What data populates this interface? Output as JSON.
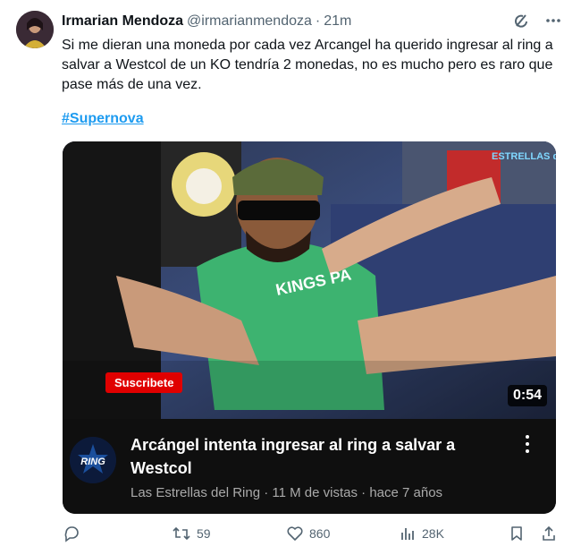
{
  "author": {
    "name": "Irmarian Mendoza",
    "handle": "@irmarianmendoza",
    "separator": "·",
    "time": "21m"
  },
  "tweet": {
    "text": "Si me dieran una moneda por cada vez Arcangel ha querido ingresar al ring a salvar a Westcol de un KO tendría 2 monedas, no es mucho pero es raro que pase más de una vez.",
    "hashtag": "#Supernova"
  },
  "video": {
    "duration": "0:54",
    "subscribe_label": "Suscribete",
    "watermark": "ESTRELLAS del RING",
    "shirt_text": "KINGS PA",
    "title": "Arcángel intenta ingresar al ring a salvar a Westcol",
    "meta": "Las Estrellas del Ring · 11 M de vistas · hace 7 años",
    "channel_logo_text": "RING"
  },
  "actions": {
    "replies": "",
    "retweets": "59",
    "likes": "860",
    "views": "28K"
  },
  "icons": {
    "grok": "grok-icon",
    "more": "more-icon",
    "reply": "reply-icon",
    "retweet": "retweet-icon",
    "like": "heart-icon",
    "views": "views-icon",
    "bookmark": "bookmark-icon",
    "share": "share-icon"
  }
}
